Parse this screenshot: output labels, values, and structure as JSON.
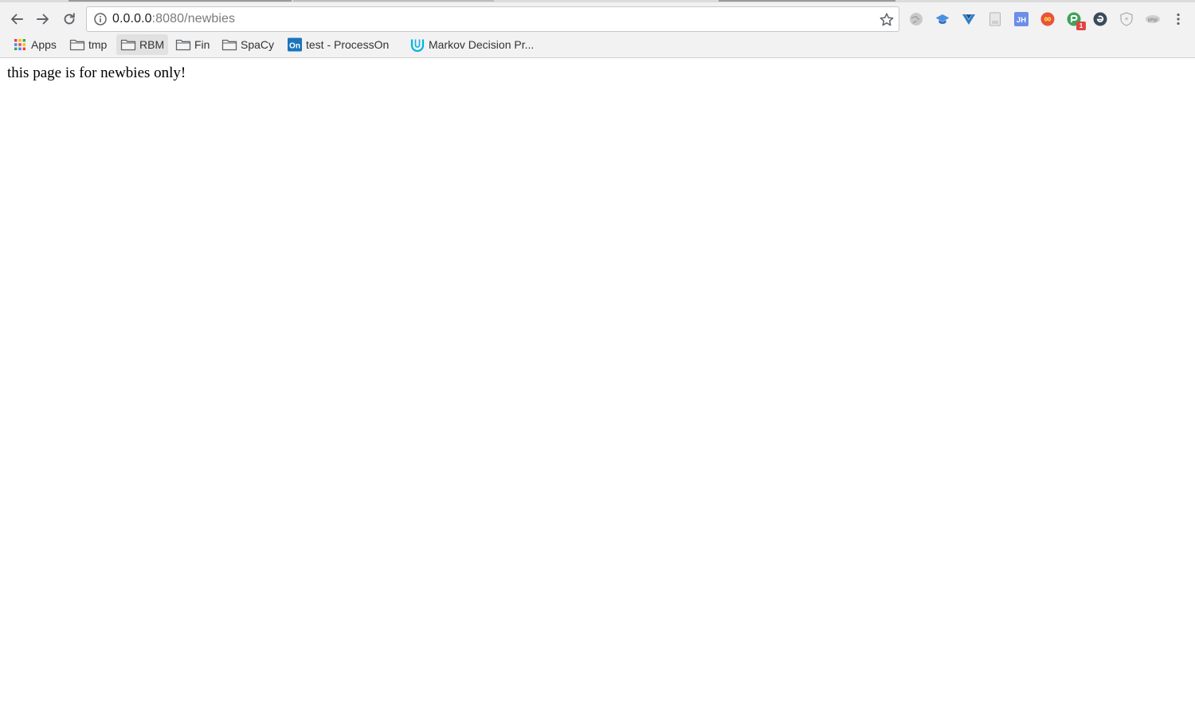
{
  "browser": {
    "address_bar": {
      "url_host": "0.0.0.0",
      "url_rest": ":8080/newbies"
    },
    "nav": {
      "back_icon": "arrow-left",
      "forward_icon": "arrow-right",
      "reload_icon": "reload"
    },
    "extensions": [
      {
        "name": "globe-extension-icon"
      },
      {
        "name": "graduation-cap-extension-icon"
      },
      {
        "name": "vue-devtools-extension-icon"
      },
      {
        "name": "document-extension-icon"
      },
      {
        "name": "jh-extension-icon",
        "text": "JH"
      },
      {
        "name": "infinity-extension-icon"
      },
      {
        "name": "green-extension-icon",
        "badge": "1"
      },
      {
        "name": "e-circle-extension-icon"
      },
      {
        "name": "shield-extension-icon"
      },
      {
        "name": "php-extension-icon",
        "text": "php"
      }
    ],
    "bookmarks": [
      {
        "label": "Apps",
        "icon": "apps-grid-icon"
      },
      {
        "label": "tmp",
        "icon": "folder-icon"
      },
      {
        "label": "RBM",
        "icon": "folder-icon",
        "active": true
      },
      {
        "label": "Fin",
        "icon": "folder-icon"
      },
      {
        "label": "SpaCy",
        "icon": "folder-icon"
      },
      {
        "label": "test - ProcessOn",
        "icon": "processon-icon",
        "icon_text": "On"
      },
      {
        "label": "Markov Decision Pr...",
        "icon": "udacity-icon"
      }
    ],
    "colors": {
      "chrome_bg": "#f2f2f2",
      "processon_blue": "#1b75bc",
      "udacity_cyan": "#02b3e4"
    }
  },
  "page": {
    "text": "this page is for newbies only!"
  }
}
